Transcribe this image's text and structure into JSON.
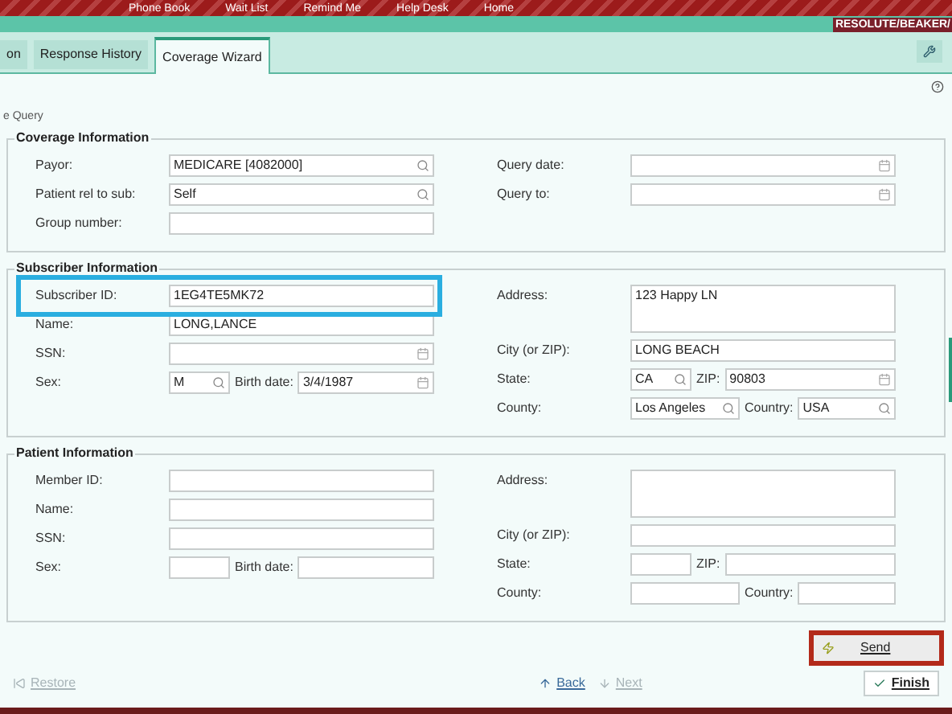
{
  "toolbar": [
    "Phone Book",
    "Wait List",
    "Remind Me",
    "Help Desk",
    "Home"
  ],
  "environment": "RESOLUTE/BEAKER/",
  "tabs": [
    {
      "label": "on",
      "selected": false
    },
    {
      "label": "Response History",
      "selected": false
    },
    {
      "label": "Coverage Wizard",
      "selected": true
    }
  ],
  "page_title": "e Query",
  "sections": [
    {
      "title": "Coverage Information",
      "left": [
        {
          "label": "Payor:",
          "kind": "single",
          "highlighted": false,
          "fields": [
            {
              "kind": "search",
              "value": "MEDICARE [4082000]"
            }
          ]
        },
        {
          "label": "Patient rel to sub:",
          "kind": "single",
          "highlighted": false,
          "fields": [
            {
              "kind": "search",
              "value": "Self"
            }
          ]
        },
        {
          "label": "Group number:",
          "kind": "single",
          "highlighted": false,
          "fields": [
            {
              "kind": "text"
            }
          ]
        }
      ],
      "right": [
        {
          "label": "Query date:",
          "kind": "single",
          "highlighted": false,
          "fields": [
            {
              "kind": "date"
            }
          ]
        },
        {
          "label": "Query to:",
          "kind": "single",
          "highlighted": false,
          "fields": [
            {
              "kind": "date"
            }
          ]
        }
      ]
    },
    {
      "title": "Subscriber Information",
      "left": [
        {
          "label": "Subscriber ID:",
          "kind": "single",
          "highlighted": true,
          "fields": [
            {
              "kind": "text",
              "value": "1EG4TE5MK72"
            }
          ]
        },
        {
          "label": "Name:",
          "kind": "single",
          "highlighted": false,
          "fields": [
            {
              "kind": "text",
              "value": "LONG,LANCE"
            }
          ]
        },
        {
          "label": "SSN:",
          "kind": "single",
          "highlighted": false,
          "fields": [
            {
              "kind": "date"
            }
          ]
        },
        {
          "label": "Sex:",
          "kind": "short-pair",
          "highlighted": false,
          "fields": [
            {
              "kind": "search",
              "value": "M"
            },
            {
              "kind": "date",
              "value": "3/4/1987",
              "prefix": "Birth date:"
            }
          ]
        }
      ],
      "right": [
        {
          "label": "Address:",
          "kind": "single",
          "highlighted": false,
          "fields": [
            {
              "kind": "textarea",
              "value": "123 Happy LN"
            }
          ]
        },
        {
          "label": "City (or ZIP):",
          "kind": "single",
          "highlighted": false,
          "fields": [
            {
              "kind": "text",
              "value": "LONG BEACH"
            }
          ]
        },
        {
          "label": "State:",
          "kind": "short-pair",
          "highlighted": false,
          "fields": [
            {
              "kind": "search",
              "value": "CA"
            },
            {
              "kind": "date",
              "value": "90803",
              "prefix": "ZIP:"
            }
          ]
        },
        {
          "label": "County:",
          "kind": "medium-pair",
          "highlighted": false,
          "fields": [
            {
              "kind": "search",
              "value": "Los Angeles"
            },
            {
              "kind": "search",
              "value": "USA",
              "prefix": "Country:"
            }
          ]
        }
      ]
    },
    {
      "title": "Patient Information",
      "left": [
        {
          "label": "Member ID:",
          "kind": "single",
          "highlighted": false,
          "fields": [
            {
              "kind": "text"
            }
          ]
        },
        {
          "label": "Name:",
          "kind": "single",
          "highlighted": false,
          "fields": [
            {
              "kind": "text"
            }
          ]
        },
        {
          "label": "SSN:",
          "kind": "single",
          "highlighted": false,
          "fields": [
            {
              "kind": "text"
            }
          ]
        },
        {
          "label": "Sex:",
          "kind": "short-pair",
          "highlighted": false,
          "fields": [
            {
              "kind": "text"
            },
            {
              "kind": "text",
              "prefix": "Birth date:"
            }
          ]
        }
      ],
      "right": [
        {
          "label": "Address:",
          "kind": "single",
          "highlighted": false,
          "fields": [
            {
              "kind": "textarea"
            }
          ]
        },
        {
          "label": "City (or ZIP):",
          "kind": "single",
          "highlighted": false,
          "fields": [
            {
              "kind": "text"
            }
          ]
        },
        {
          "label": "State:",
          "kind": "short-pair",
          "highlighted": false,
          "fields": [
            {
              "kind": "text"
            },
            {
              "kind": "text",
              "prefix": "ZIP:"
            }
          ]
        },
        {
          "label": "County:",
          "kind": "medium-pair",
          "highlighted": false,
          "fields": [
            {
              "kind": "text"
            },
            {
              "kind": "text",
              "prefix": "Country:"
            }
          ]
        }
      ]
    }
  ],
  "send": {
    "label": "Send",
    "highlighted": true
  },
  "footer": [
    {
      "label": "Restore",
      "disabled": true,
      "kind": "restore"
    },
    {
      "label": "Back",
      "disabled": false,
      "kind": "back"
    },
    {
      "label": "Next",
      "disabled": true,
      "kind": "next"
    },
    {
      "label": "Finish",
      "disabled": false,
      "kind": "finish"
    }
  ]
}
